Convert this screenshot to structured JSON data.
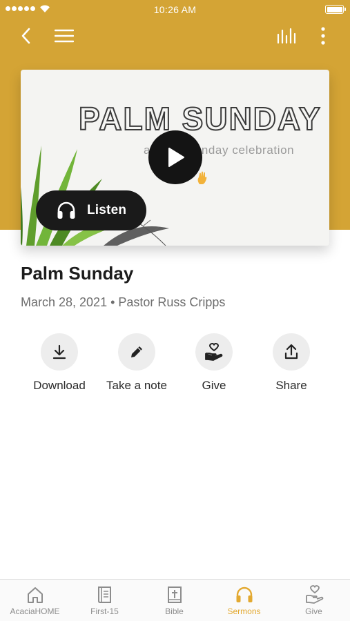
{
  "status_bar": {
    "time": "10:26 AM"
  },
  "colors": {
    "accent": "#d4a435",
    "tab_active": "#e3a930",
    "dark_button": "#141414"
  },
  "header": {
    "icons": [
      "back-icon",
      "menu-icon",
      "equalizer-icon",
      "more-vertical-icon"
    ]
  },
  "artwork": {
    "title": "PALM SUNDAY",
    "subtitle": "a Palm Sunday celebration"
  },
  "player": {
    "listen_label": "Listen"
  },
  "sermon": {
    "title": "Palm Sunday",
    "meta": "March 28, 2021 • Pastor Russ Cripps"
  },
  "actions": [
    {
      "label": "Download",
      "icon": "download-icon"
    },
    {
      "label": "Take a note",
      "icon": "pencil-icon"
    },
    {
      "label": "Give",
      "icon": "give-hand-heart-icon"
    },
    {
      "label": "Share",
      "icon": "share-upload-icon"
    }
  ],
  "tabs": [
    {
      "label": "AcaciaHOME",
      "icon": "home-icon",
      "active": false
    },
    {
      "label": "First-15",
      "icon": "book-icon",
      "active": false
    },
    {
      "label": "Bible",
      "icon": "bible-icon",
      "active": false
    },
    {
      "label": "Sermons",
      "icon": "headphones-icon",
      "active": true
    },
    {
      "label": "Give",
      "icon": "give-hand-heart-icon",
      "active": false
    }
  ]
}
